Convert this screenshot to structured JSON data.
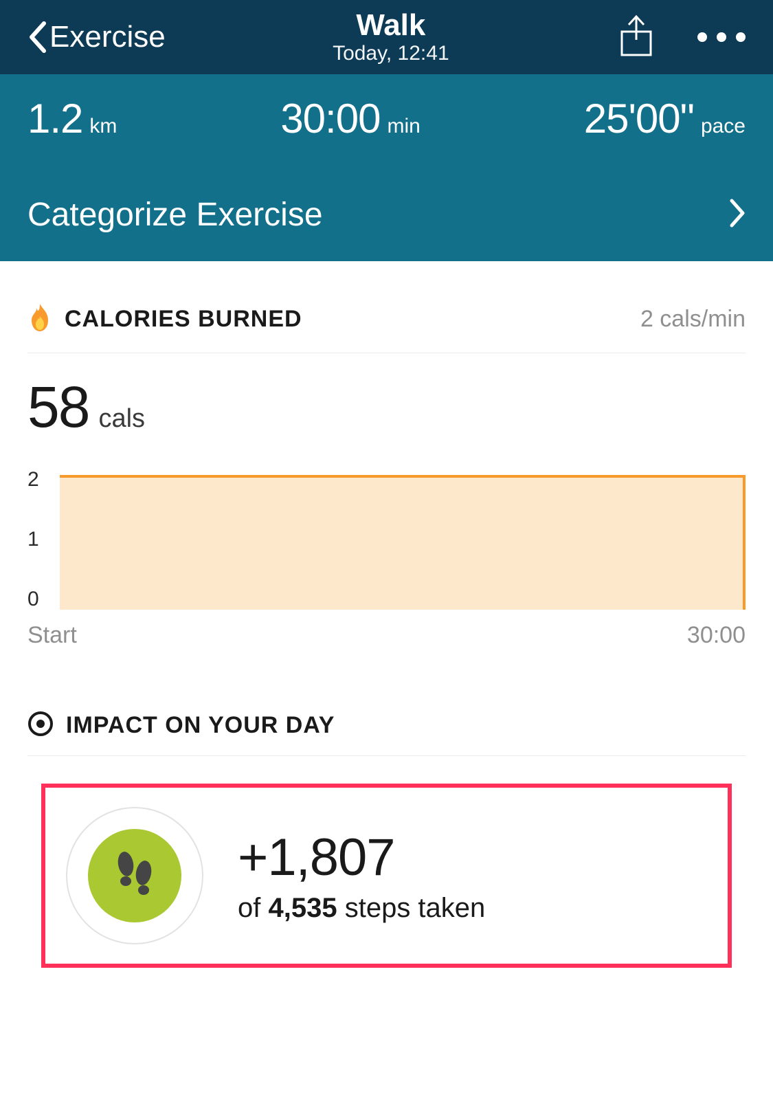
{
  "header": {
    "back_label": "Exercise",
    "title": "Walk",
    "subtitle": "Today, 12:41"
  },
  "stats": {
    "distance_value": "1.2",
    "distance_unit": "km",
    "duration_value": "30:00",
    "duration_unit": "min",
    "pace_value": "25'00\"",
    "pace_unit": "pace"
  },
  "categorize": {
    "label": "Categorize Exercise"
  },
  "calories": {
    "title": "CALORIES BURNED",
    "rate": "2 cals/min",
    "total_value": "58",
    "total_unit": "cals"
  },
  "chart_data": {
    "type": "area",
    "xlabel_start": "Start",
    "xlabel_end": "30:00",
    "ylim": [
      0,
      2
    ],
    "y_ticks": [
      "2",
      "1",
      "0"
    ],
    "series": [
      {
        "name": "cals/min",
        "x": [
          "Start",
          "30:00"
        ],
        "values": [
          2,
          2
        ]
      }
    ]
  },
  "impact": {
    "title": "IMPACT ON YOUR DAY",
    "steps_added": "+1,807",
    "of_word": "of ",
    "steps_total": "4,535",
    "tail": " steps taken"
  },
  "colors": {
    "header_bg": "#0d3a54",
    "band_bg": "#13708b",
    "accent_orange": "#f89b2c",
    "accent_green": "#a9c832",
    "highlight_border": "#ff3059"
  }
}
